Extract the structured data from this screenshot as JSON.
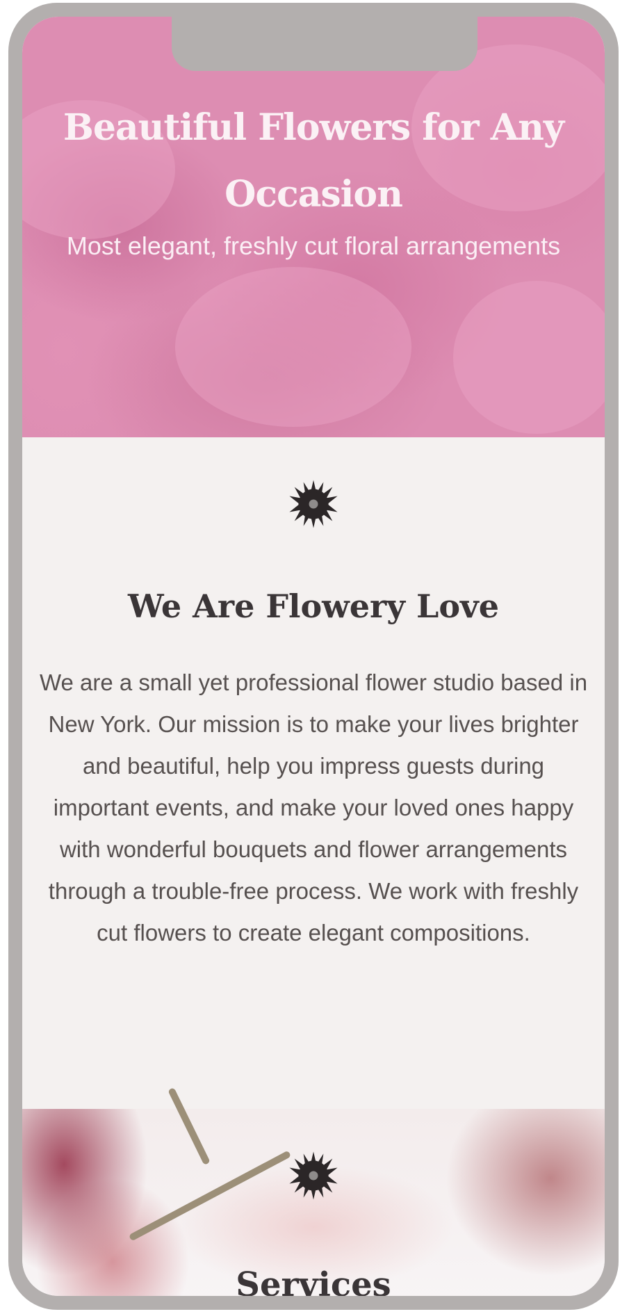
{
  "hero": {
    "title": "Beautiful Flowers for Any Occasion",
    "subtitle": "Most elegant, freshly cut floral arrangements"
  },
  "about": {
    "icon": "flower-icon",
    "title": "We Are Flowery Love",
    "text": "We are a small yet professional flower studio based in New York. Our mission is to make your lives brighter and beautiful, help you impress guests during important events, and make your loved ones happy with wonderful bouquets and flower arrangements through a trouble-free process. We work with freshly cut flowers to create elegant compositions."
  },
  "services": {
    "icon": "flower-icon",
    "title": "Services"
  },
  "colors": {
    "frame": "#b3afae",
    "hero_pink": "#dd8db2",
    "section_bg": "#f4f1f0",
    "heading_text": "#3a3537"
  }
}
